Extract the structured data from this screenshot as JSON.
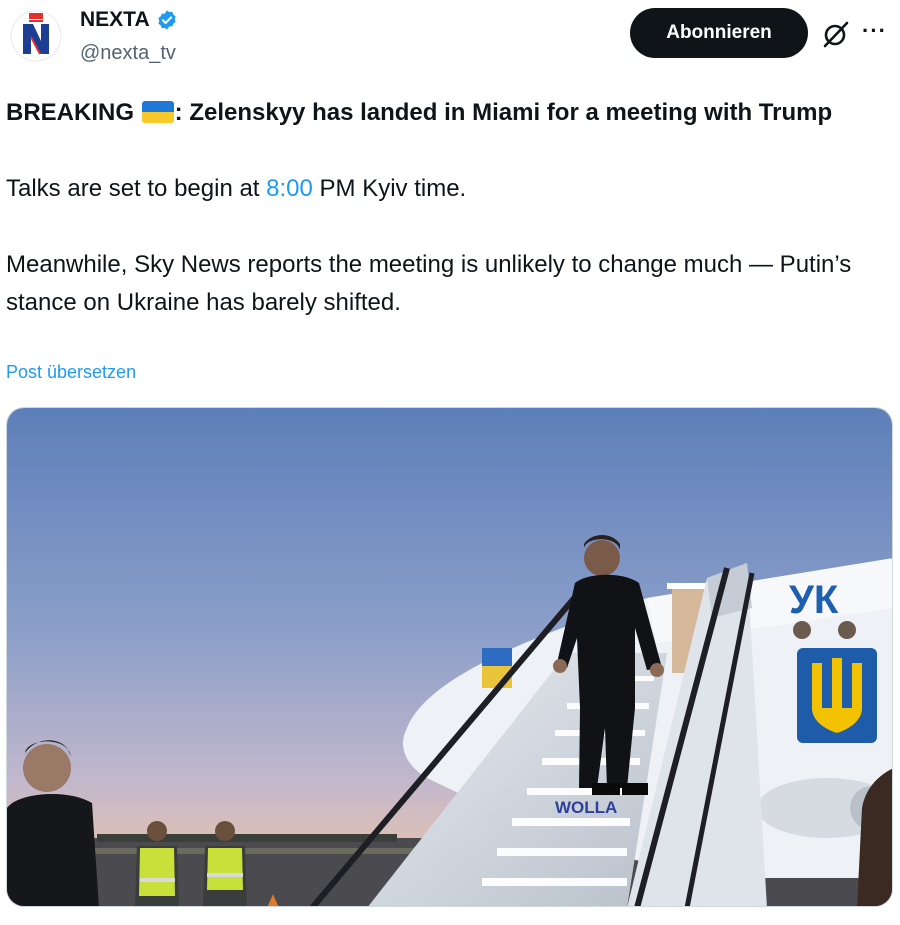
{
  "account": {
    "display_name": "NEXTA",
    "handle": "@nexta_tv",
    "avatar_icon": "nexta-logo-icon",
    "verified_icon": "verified-badge-icon"
  },
  "actions": {
    "follow_label": "Abonnieren",
    "grok_icon": "grok-icon",
    "more_icon": "more-options-icon",
    "more_glyph": "···"
  },
  "tweet": {
    "headline_prefix": "BREAKING ",
    "headline_flag": "ukraine-flag-icon",
    "headline_rest": ": Zelenskyy has landed in Miami for a meeting with Trump",
    "para1_before": "Talks are set to begin at ",
    "para1_time": "8:00",
    "para1_after": " PM Kyiv time.",
    "para2": "Meanwhile, Sky News reports the meeting is unlikely to change much — Putin’s stance on Ukraine has barely shifted.",
    "translate_label": "Post übersetzen"
  },
  "media": {
    "plane_text": "УК",
    "stairs_text": "WOLLA"
  },
  "colors": {
    "link": "#1d9bf0",
    "button_bg": "#0f1419",
    "verified": "#1d9bf0",
    "flag_blue": "#1d78d8",
    "flag_yellow": "#f7ca2a"
  }
}
